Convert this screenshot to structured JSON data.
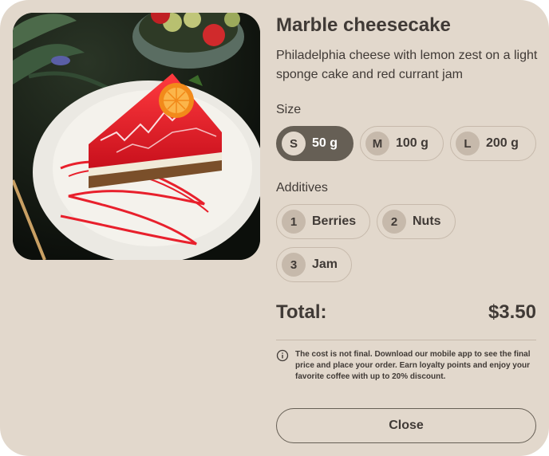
{
  "product": {
    "title": "Marble cheesecake",
    "description": "Philadelphia cheese with lemon zest on a light sponge cake and red currant jam"
  },
  "size": {
    "label": "Size",
    "options": [
      {
        "tag": "S",
        "value": "50 g",
        "selected": true
      },
      {
        "tag": "M",
        "value": "100 g",
        "selected": false
      },
      {
        "tag": "L",
        "value": "200 g",
        "selected": false
      }
    ]
  },
  "additives": {
    "label": "Additives",
    "options": [
      {
        "tag": "1",
        "value": "Berries",
        "selected": false
      },
      {
        "tag": "2",
        "value": "Nuts",
        "selected": false
      },
      {
        "tag": "3",
        "value": "Jam",
        "selected": false
      }
    ]
  },
  "total": {
    "label": "Total:",
    "value": "$3.50"
  },
  "note": {
    "icon": "info-icon",
    "text": "The cost is not final. Download our mobile app to see the final price and place your order. Earn loyalty points and enjoy your favorite coffee with up to 20% discount."
  },
  "close_label": "Close",
  "colors": {
    "background": "#e2d8cc",
    "text": "#403a36",
    "accent_dark": "#665f55",
    "chip_border": "#c6b9ab"
  }
}
